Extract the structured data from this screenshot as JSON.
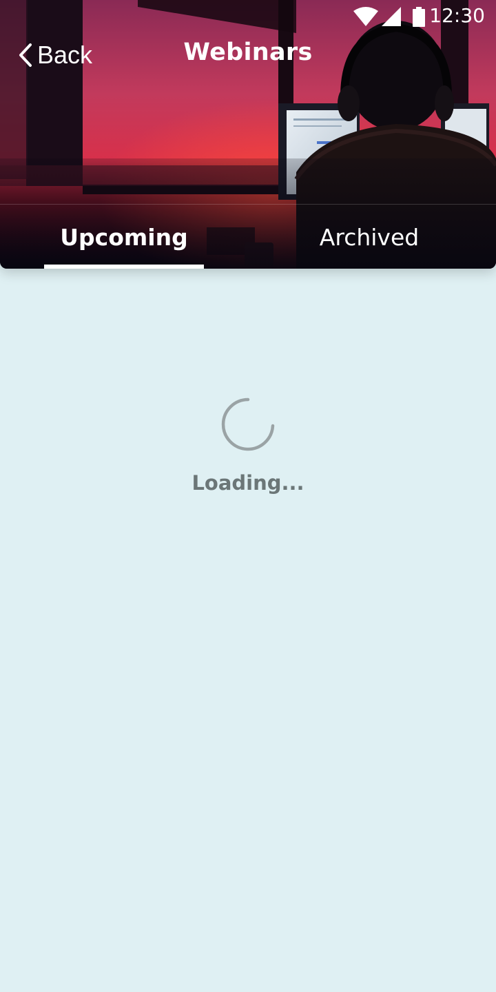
{
  "status_bar": {
    "time": "12:30",
    "icons": [
      "wifi-icon",
      "cellular-signal-icon",
      "battery-icon"
    ]
  },
  "header": {
    "back_label": "Back",
    "title": "Webinars",
    "background": "photo of a person wearing headphones at a computer in front of a red sunset window"
  },
  "tabs": [
    {
      "label": "Upcoming",
      "selected": true
    },
    {
      "label": "Archived",
      "selected": false
    }
  ],
  "main": {
    "loading_text": "Loading..."
  },
  "colors": {
    "page_background": "#dff0f3",
    "header_overlay": "#0b0a1a",
    "accent_red": "#d8304a",
    "loading_text": "#6b7677",
    "spinner": "#9aa3a5"
  }
}
